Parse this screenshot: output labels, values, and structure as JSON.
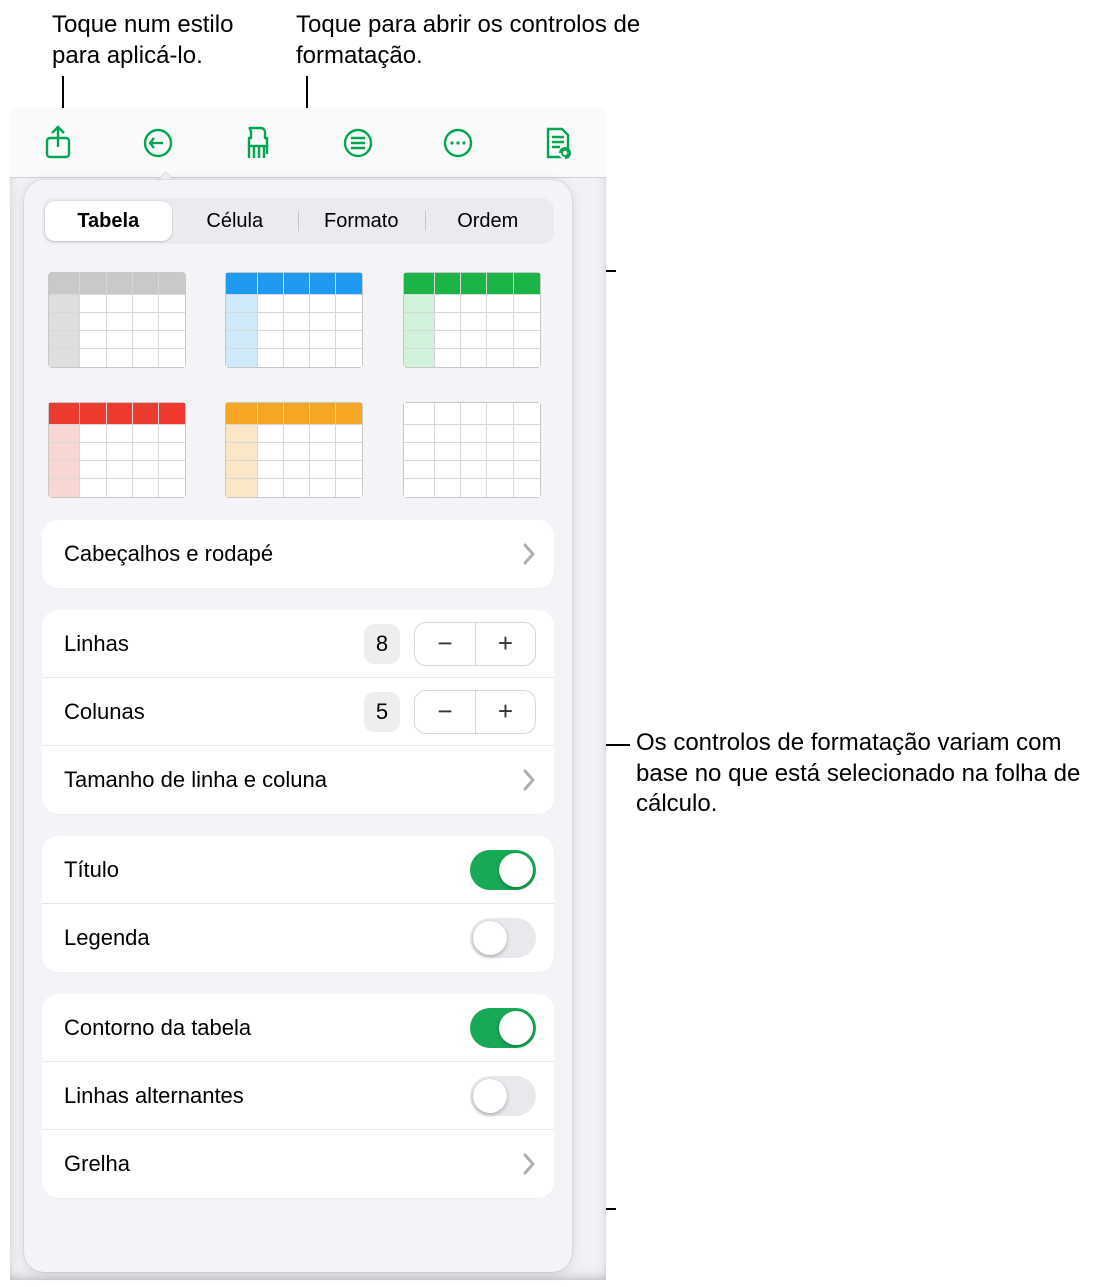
{
  "callouts": {
    "top_left": "Toque num estilo para aplicá-lo.",
    "top_center": "Toque para abrir os controlos de formatação.",
    "right": "Os controlos de formatação variam com base no que está selecionado na folha de cálculo."
  },
  "toolbar": {
    "accent": "#00a650",
    "icons": [
      "share",
      "undo",
      "format-brush",
      "insert",
      "more",
      "document-settings"
    ]
  },
  "tabs": {
    "items": [
      {
        "label": "Tabela",
        "active": true
      },
      {
        "label": "Célula",
        "active": false
      },
      {
        "label": "Formato",
        "active": false
      },
      {
        "label": "Ordem",
        "active": false
      }
    ]
  },
  "styles": [
    {
      "name": "gray",
      "header": "#c9c9c9",
      "side": "#dedede"
    },
    {
      "name": "blue",
      "header": "#1e9bf0",
      "side": "#cfe9fb"
    },
    {
      "name": "green",
      "header": "#1db447",
      "side": "#d2f1da"
    },
    {
      "name": "red",
      "header": "#ef3b2f",
      "side": "#f9d6d3"
    },
    {
      "name": "orange",
      "header": "#f5a623",
      "side": "#fbe7c7"
    },
    {
      "name": "plain",
      "header": "#ffffff",
      "side": "#ffffff"
    }
  ],
  "headers_footers": {
    "label": "Cabeçalhos e rodapé"
  },
  "rows": {
    "label": "Linhas",
    "value": "8"
  },
  "cols": {
    "label": "Colunas",
    "value": "5"
  },
  "size": {
    "label": "Tamanho de linha e coluna"
  },
  "title": {
    "label": "Título",
    "on": true
  },
  "caption": {
    "label": "Legenda",
    "on": false
  },
  "outline": {
    "label": "Contorno da tabela",
    "on": true
  },
  "alternating": {
    "label": "Linhas alternantes",
    "on": false
  },
  "grid": {
    "label": "Grelha"
  }
}
